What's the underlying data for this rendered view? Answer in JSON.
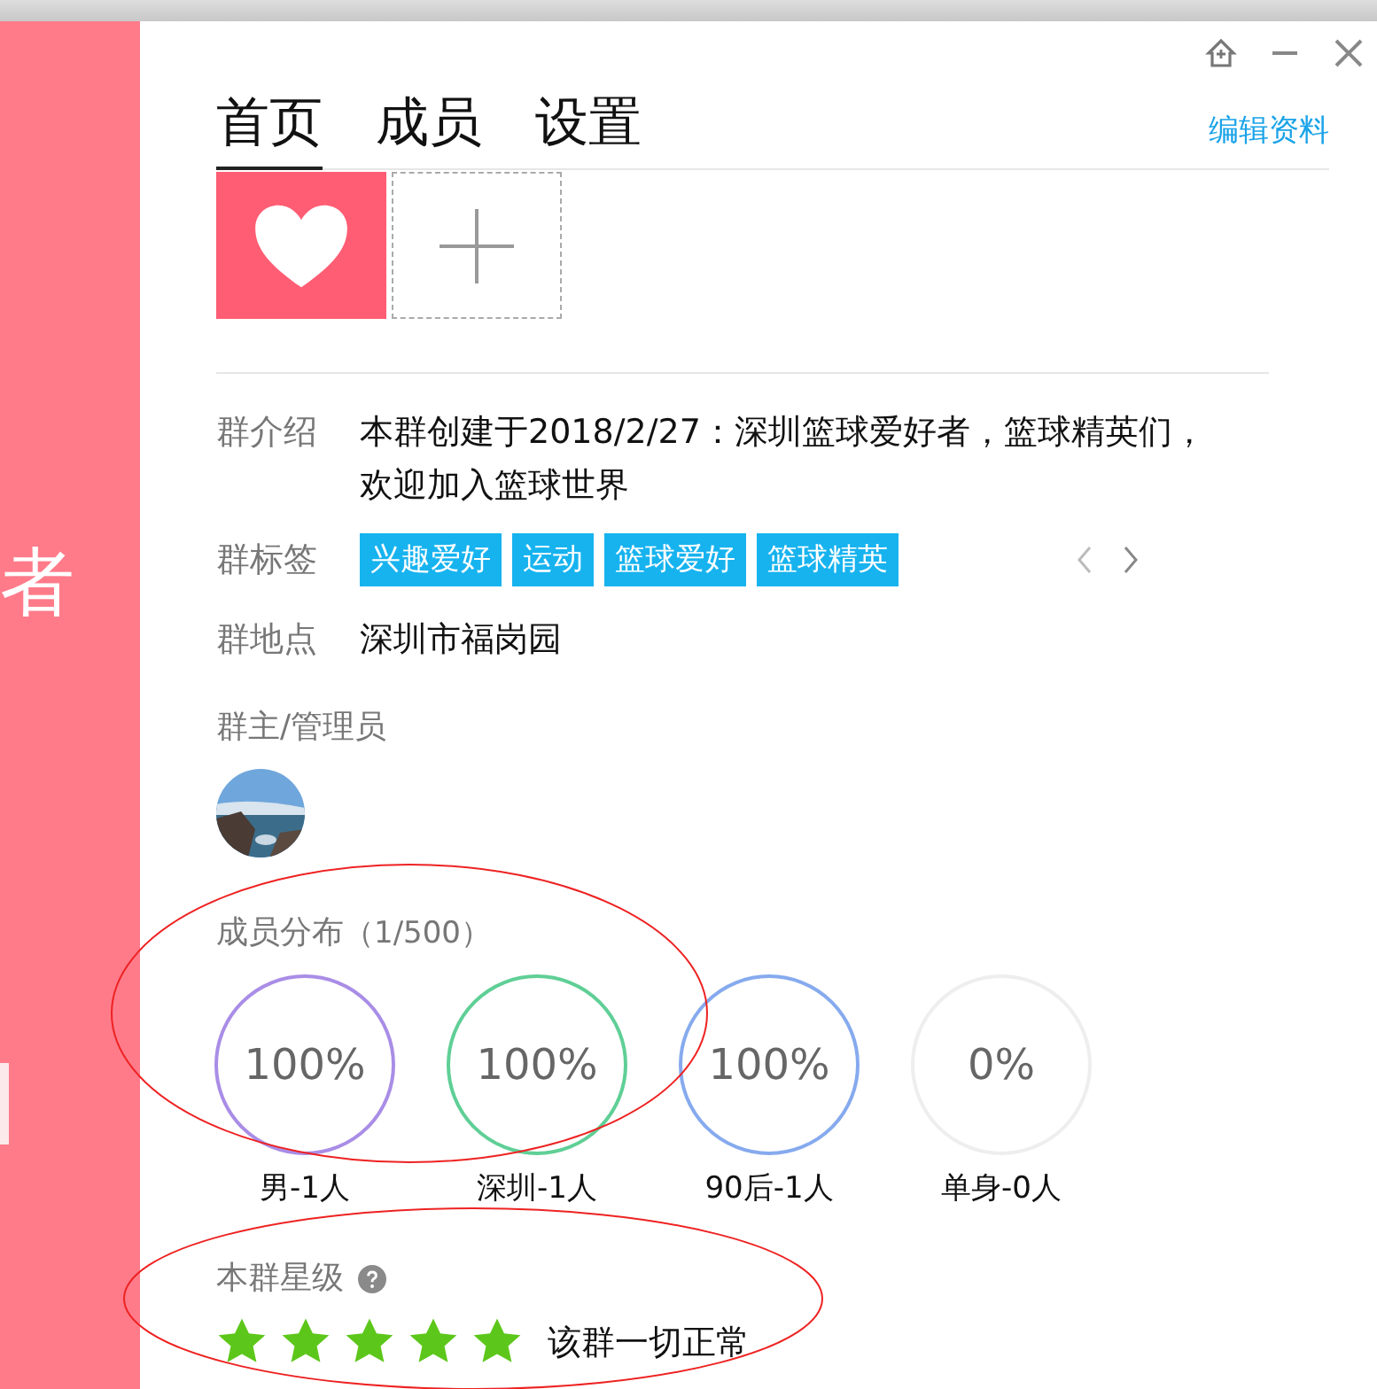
{
  "side_panel": {
    "text": "者"
  },
  "tabs": [
    {
      "label": "首页",
      "selected": true
    },
    {
      "label": "成员",
      "selected": false
    },
    {
      "label": "设置",
      "selected": false
    }
  ],
  "edit_link": "编辑资料",
  "info": [
    {
      "label": "群介绍",
      "value": "本群创建于2018/2/27：深圳篮球爱好者，篮球精英们，欢迎加入篮球世界"
    },
    {
      "label": "群标签",
      "tags": [
        "兴趣爱好",
        "运动",
        "篮球爱好",
        "篮球精英"
      ]
    },
    {
      "label": "群地点",
      "value": "深圳市福岗园"
    }
  ],
  "admins": {
    "label": "群主/管理员"
  },
  "distribution": {
    "title": "成员分布",
    "count": "（1/500）",
    "items": [
      {
        "value": "100%",
        "label": "男-1人",
        "color": "#a98de6"
      },
      {
        "value": "100%",
        "label": "深圳-1人",
        "color": "#5fcf96"
      },
      {
        "value": "100%",
        "label": "90后-1人",
        "color": "#86aaee"
      },
      {
        "value": "0%",
        "label": "单身-0人",
        "color": "#eeeeee"
      }
    ]
  },
  "rating": {
    "title": "本群星级",
    "stars": 5,
    "status": "该群一切正常"
  }
}
